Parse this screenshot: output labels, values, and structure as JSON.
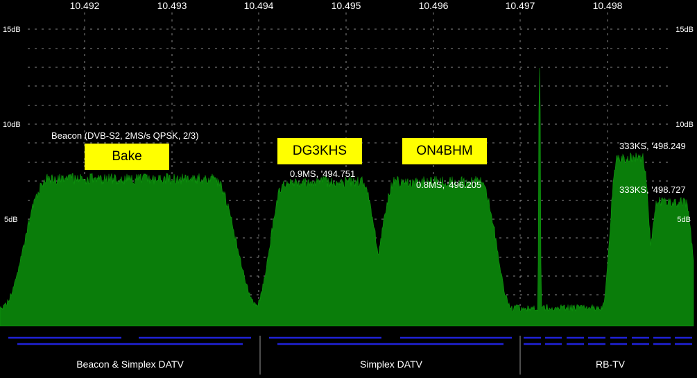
{
  "colors": {
    "background": "#000000",
    "spectrum": "#0a7d0a",
    "grid": "#8a8a8a",
    "band": "#1f22d8",
    "label_bg": "#ffff00"
  },
  "freq_axis": {
    "ticks": [
      "10.492",
      "10.493",
      "10.494",
      "10.495",
      "10.496",
      "10.497",
      "10.498"
    ]
  },
  "level_axis": {
    "ticks": [
      "15dB",
      "10dB",
      "5dB"
    ]
  },
  "annotations": {
    "beacon_desc": "Beacon (DVB-S2, 2MS/s QPSK, 2/3)",
    "dg3khs_info": "0.9MS, '494.751",
    "on4bhm_info": "0.8MS, '496.205",
    "rb1_info": "333KS, '498.249",
    "rb2_info": "333KS, '498.727"
  },
  "callsigns": {
    "beacon": "Bake",
    "dg3khs": "DG3KHS",
    "on4bhm": "ON4BHM"
  },
  "band_segments": {
    "beacon_simplex": "Beacon & Simplex DATV",
    "simplex": "Simplex DATV",
    "rb_tv": "RB-TV"
  }
}
